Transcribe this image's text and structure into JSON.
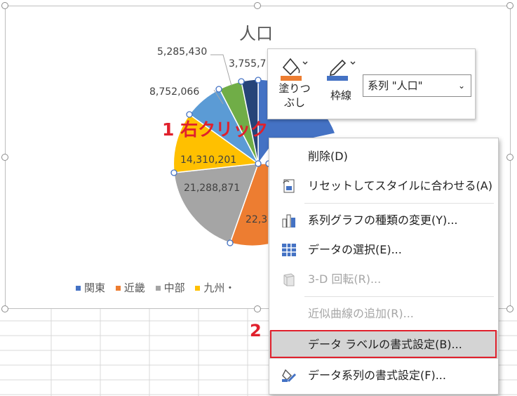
{
  "chart": {
    "title": "人口",
    "labels": {
      "l1": "5,285,430",
      "l2": "3,755,7",
      "l3": "8,752,066",
      "l4": "14,310,201",
      "l5": "21,288,871",
      "l6": "22,3"
    },
    "legend": [
      {
        "label": "関東",
        "color": "#4472c4"
      },
      {
        "label": "近畿",
        "color": "#ed7d31"
      },
      {
        "label": "中部",
        "color": "#a5a5a5"
      },
      {
        "label": "九州・",
        "color": "#ffc000"
      }
    ]
  },
  "mini_toolbar": {
    "fill_label_1": "塗りつ",
    "fill_label_2": "ぶし",
    "outline_label": "枠線",
    "series_select": "系列 \"人口\""
  },
  "annotations": {
    "step1": "1 右クリック",
    "step2": "2"
  },
  "context_menu": {
    "items": [
      {
        "label": "削除(D)"
      },
      {
        "label": "リセットしてスタイルに合わせる(A)"
      },
      {
        "label": "系列グラフの種類の変更(Y)..."
      },
      {
        "label": "データの選択(E)..."
      },
      {
        "label": "3-D 回転(R)..."
      },
      {
        "label": "近似曲線の追加(R)..."
      },
      {
        "label": "データ ラベルの書式設定(B)..."
      },
      {
        "label": "データ系列の書式設定(F)..."
      }
    ]
  },
  "colors": {
    "blue": "#4472c4",
    "orange": "#ed7d31",
    "gray": "#a5a5a5",
    "gold": "#ffc000",
    "lightblue": "#5b9bd5",
    "green": "#70ad47",
    "navy": "#264478",
    "accent_red": "#e0202c"
  }
}
